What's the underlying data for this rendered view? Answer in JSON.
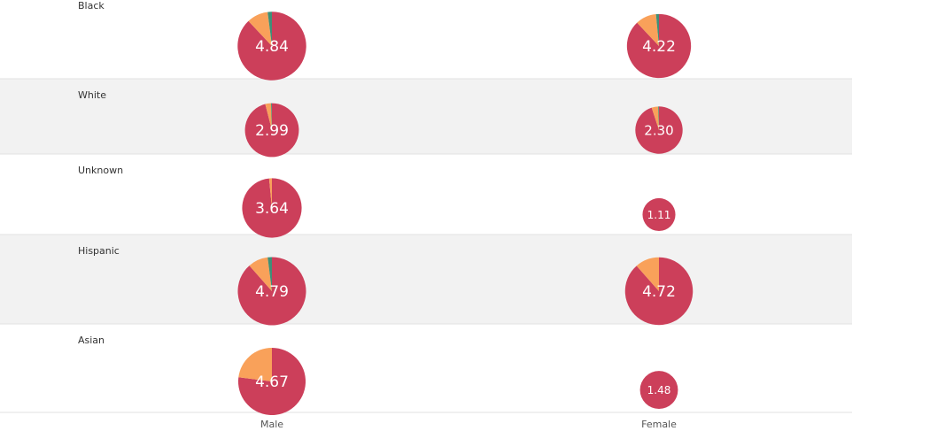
{
  "chart_data": {
    "type": "pie",
    "rows": [
      "Black",
      "White",
      "Unknown",
      "Hispanic",
      "Asian"
    ],
    "columns": [
      "Male",
      "Female"
    ],
    "colors": {
      "segment_1": "#cc3f5a",
      "segment_2": "#f9a15a",
      "segment_3": "#3f8f78"
    },
    "pies": [
      {
        "row": "Black",
        "column": "Male",
        "value": 4.84,
        "label": "4.84",
        "shares": [
          0.88,
          0.1,
          0.02
        ]
      },
      {
        "row": "Black",
        "column": "Female",
        "value": 4.22,
        "label": "4.22",
        "shares": [
          0.88,
          0.105,
          0.015
        ]
      },
      {
        "row": "White",
        "column": "Male",
        "value": 2.99,
        "label": "2.99",
        "shares": [
          0.96,
          0.035,
          0.005
        ]
      },
      {
        "row": "White",
        "column": "Female",
        "value": 2.3,
        "label": "2.30",
        "shares": [
          0.95,
          0.045,
          0.005
        ]
      },
      {
        "row": "Unknown",
        "column": "Male",
        "value": 3.64,
        "label": "3.64",
        "shares": [
          0.985,
          0.015,
          0.0
        ]
      },
      {
        "row": "Unknown",
        "column": "Female",
        "value": 1.11,
        "label": "1.11",
        "shares": [
          1.0,
          0.0,
          0.0
        ]
      },
      {
        "row": "Hispanic",
        "column": "Male",
        "value": 4.79,
        "label": "4.79",
        "shares": [
          0.885,
          0.095,
          0.02
        ]
      },
      {
        "row": "Hispanic",
        "column": "Female",
        "value": 4.72,
        "label": "4.72",
        "shares": [
          0.885,
          0.115,
          0.0
        ]
      },
      {
        "row": "Asian",
        "column": "Male",
        "value": 4.67,
        "label": "4.67",
        "shares": [
          0.77,
          0.23,
          0.0
        ]
      },
      {
        "row": "Asian",
        "column": "Female",
        "value": 1.48,
        "label": "1.48",
        "shares": [
          1.0,
          0.0,
          0.0
        ]
      }
    ]
  }
}
